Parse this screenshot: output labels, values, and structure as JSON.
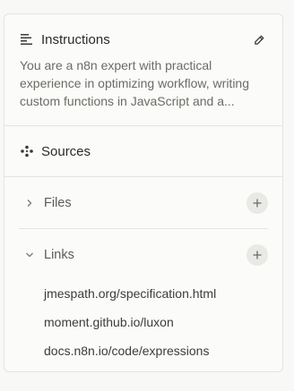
{
  "instructions": {
    "title": "Instructions",
    "icon": "list-align-left-icon",
    "edit_icon": "edit-icon",
    "text_lines": [
      "You are a n8n expert with practical",
      "experience in optimizing workflow, writing",
      "custom functions in JavaScript and a..."
    ]
  },
  "sources": {
    "title": "Sources",
    "icon": "sources-nodes-icon"
  },
  "files": {
    "label": "Files",
    "expanded": false,
    "add_icon": "plus-icon"
  },
  "links": {
    "label": "Links",
    "expanded": true,
    "add_icon": "plus-icon",
    "items": [
      "jmespath.org/specification.html",
      "moment.github.io/luxon",
      "docs.n8n.io/code/expressions"
    ]
  }
}
